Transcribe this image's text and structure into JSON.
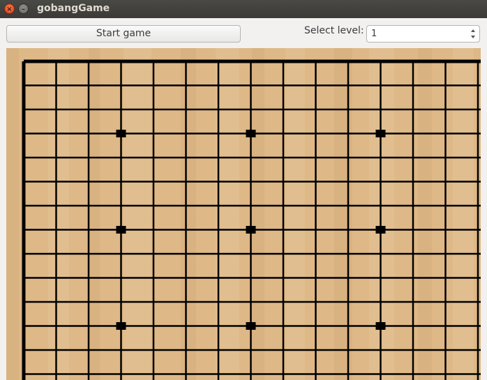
{
  "window": {
    "title": "gobangGame",
    "close_glyph": "×",
    "minimize_glyph": "–"
  },
  "toolbar": {
    "start_label": "Start game",
    "level_label": "Select level:",
    "level_value": "1"
  },
  "board": {
    "star_points": [
      {
        "col": 3,
        "row": 3
      },
      {
        "col": 7,
        "row": 3
      },
      {
        "col": 11,
        "row": 3
      },
      {
        "col": 3,
        "row": 7
      },
      {
        "col": 7,
        "row": 7
      },
      {
        "col": 11,
        "row": 7
      },
      {
        "col": 3,
        "row": 11
      },
      {
        "col": 7,
        "row": 11
      },
      {
        "col": 11,
        "row": 11
      }
    ],
    "colors": {
      "wood_base": "#deb887",
      "wood_light": "#e8c99e",
      "wood_dark": "#cfa574",
      "line": "#000000"
    },
    "icons": {
      "close": "close-icon",
      "minimize": "minimize-icon",
      "spin_up": "chevron-up-icon",
      "spin_down": "chevron-down-icon"
    }
  }
}
